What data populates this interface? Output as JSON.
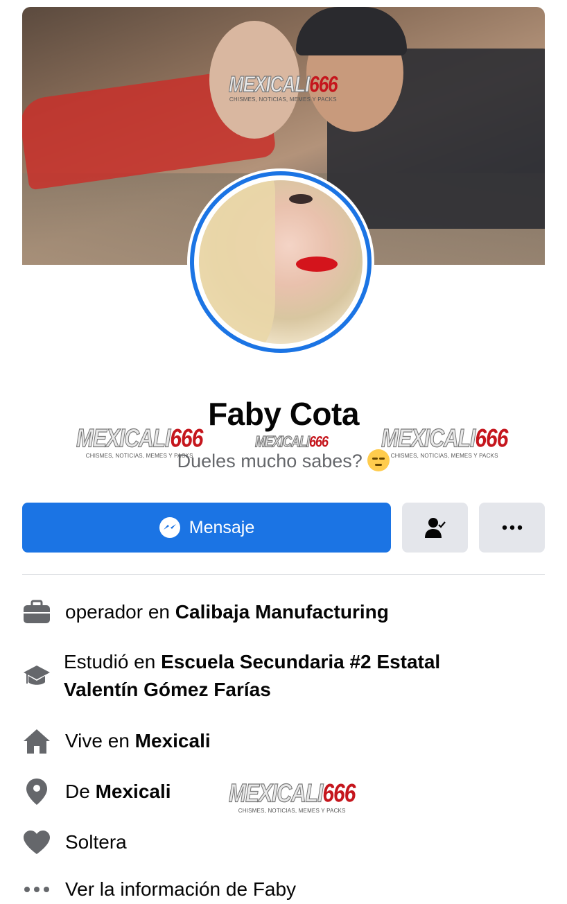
{
  "profile": {
    "name": "Faby Cota",
    "bio": "Dueles mucho sabes?"
  },
  "watermark": {
    "brand_a": "MEXICALI",
    "brand_b": "666",
    "tagline": "CHISMES, NOTICIAS, MEMES Y PACKS"
  },
  "actions": {
    "message_label": "Mensaje"
  },
  "info": {
    "work_prefix": "operador en",
    "work_place": "Calibaja Manufacturing",
    "study_prefix": "Estudió en",
    "study_place_line1": "Escuela Secundaria #2 Estatal",
    "study_place_line2": "Valentín Gómez Farías",
    "lives_prefix": "Vive en",
    "lives_place": "Mexicali",
    "from_prefix": "De",
    "from_place": "Mexicali",
    "relationship": "Soltera",
    "see_more": "Ver la información de Faby"
  },
  "colors": {
    "accent": "#1b74e4",
    "icon_gray": "#65676b"
  }
}
